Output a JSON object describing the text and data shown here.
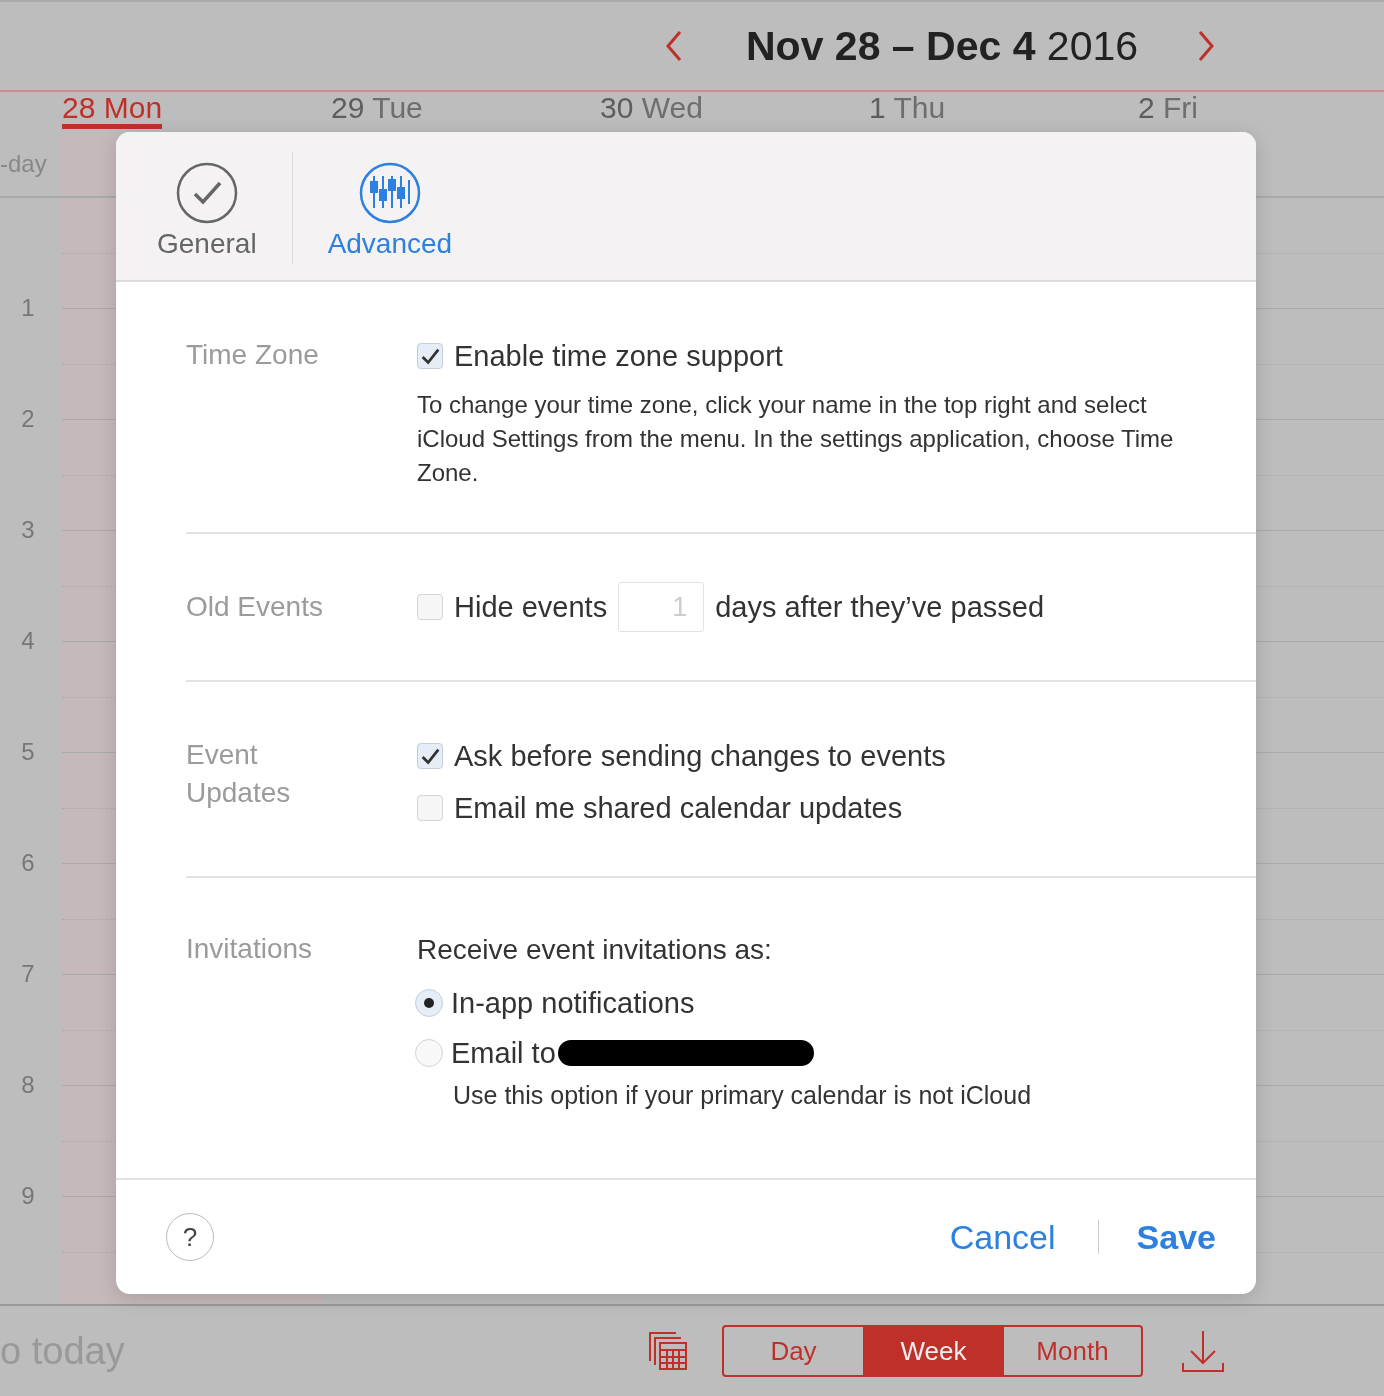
{
  "calendar": {
    "title_main": "Nov 28 – Dec 4",
    "title_year": "2016",
    "all_day_label": "-day",
    "days": [
      {
        "number": "28",
        "name": "Mon",
        "selected": true
      },
      {
        "number": "29",
        "name": "Tue",
        "selected": false
      },
      {
        "number": "30",
        "name": "Wed",
        "selected": false
      },
      {
        "number": "1",
        "name": "Thu",
        "selected": false
      },
      {
        "number": "2",
        "name": "Fri",
        "selected": false
      }
    ],
    "hours": [
      "1",
      "2",
      "3",
      "4",
      "5",
      "6",
      "7",
      "8",
      "9"
    ]
  },
  "dialog": {
    "tabs": [
      {
        "label": "General",
        "kind": "check",
        "selected": false
      },
      {
        "label": "Advanced",
        "kind": "sliders",
        "selected": true
      }
    ],
    "sections": [
      {
        "label": "Time Zone",
        "items": [
          {
            "kind": "checkbox",
            "label": "Enable time zone support",
            "checked": true
          },
          {
            "kind": "note",
            "text": "To change your time zone, click your name in the top right and select iCloud Settings from the menu. In the settings application, choose Time Zone."
          }
        ]
      },
      {
        "label": "Old Events",
        "items": [
          {
            "kind": "checkbox_field",
            "label": "Hide events",
            "checked": false,
            "value": "1",
            "suffix": "days after they’ve passed"
          }
        ]
      },
      {
        "label": "Event Updates",
        "items": [
          {
            "kind": "checkbox",
            "label": "Ask before sending changes to events",
            "checked": true
          },
          {
            "kind": "checkbox",
            "label": "Email me shared calendar updates",
            "checked": false
          }
        ]
      },
      {
        "label": "Invitations",
        "items": [
          {
            "kind": "text",
            "text": "Receive event invitations as:"
          },
          {
            "kind": "radio",
            "label": "In-app notifications",
            "selected": true
          },
          {
            "kind": "radio",
            "label": "Email to",
            "selected": false,
            "redacted": true
          },
          {
            "kind": "subnote",
            "text": "Use this option if your primary calendar is not iCloud"
          }
        ]
      }
    ],
    "help": "?",
    "buttons": [
      {
        "label": "Cancel",
        "kind": "secondary"
      },
      {
        "label": "Save",
        "kind": "primary"
      }
    ]
  },
  "bottom_bar": {
    "today_label": "o today",
    "views": [
      {
        "label": "Day",
        "selected": false
      },
      {
        "label": "Week",
        "selected": true
      },
      {
        "label": "Month",
        "selected": false
      }
    ]
  }
}
